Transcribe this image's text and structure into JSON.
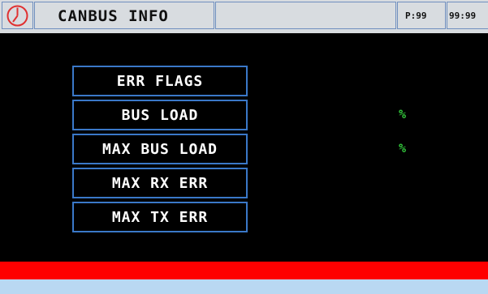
{
  "header": {
    "title": "CANBUS INFO",
    "page_indicator": "P:99",
    "time": "99:99"
  },
  "menu": {
    "items": [
      {
        "label": "ERR FLAGS",
        "unit": ""
      },
      {
        "label": "BUS LOAD",
        "unit": "%"
      },
      {
        "label": "MAX BUS LOAD",
        "unit": "%"
      },
      {
        "label": "MAX RX ERR",
        "unit": ""
      },
      {
        "label": "MAX TX ERR",
        "unit": ""
      }
    ]
  },
  "colors": {
    "background": "#000000",
    "title_bar": "#d8dce0",
    "button_border": "#3a78c8",
    "value_unit": "#31c43a",
    "alarm_bar": "#ff0000",
    "status_bar": "#b9d8f2",
    "clock_icon": "#e03030"
  },
  "icons": {
    "clock": "clock-icon"
  }
}
